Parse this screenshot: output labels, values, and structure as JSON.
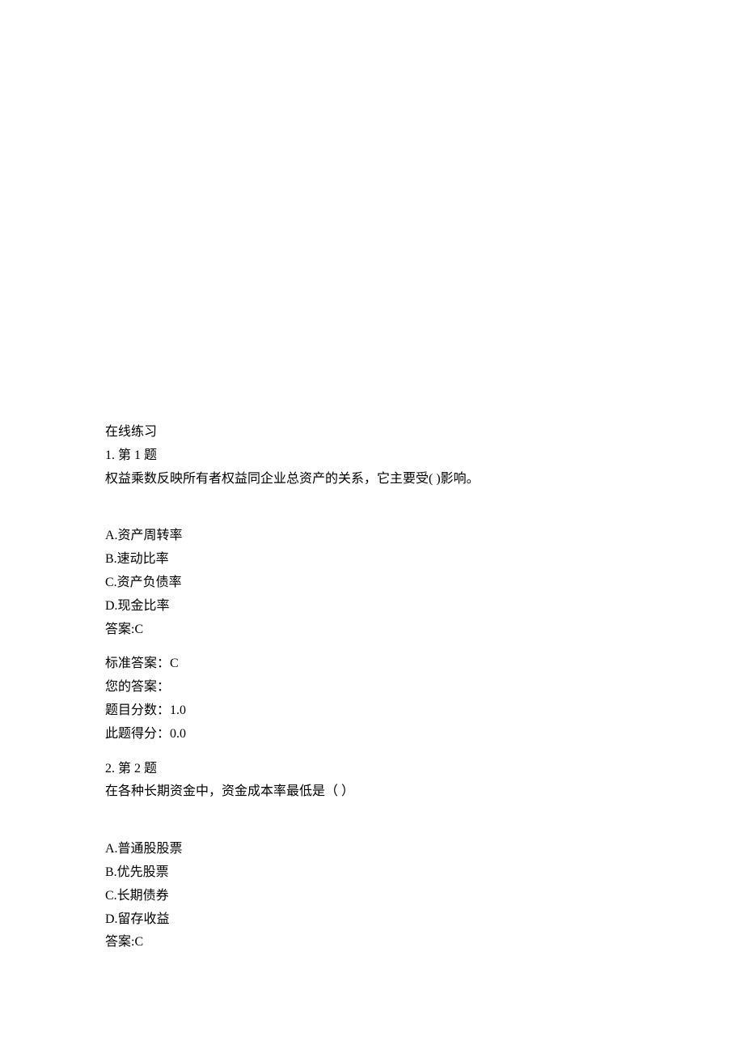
{
  "header": {
    "title": "在线练习"
  },
  "questions": [
    {
      "number_label": "1.  第 1 题",
      "stem": "权益乘数反映所有者权益同企业总资产的关系，它主要受( )影响。",
      "options": [
        "A.资产周转率",
        "B.速动比率",
        "C.资产负债率",
        "D.现金比率"
      ],
      "answer_line": "答案:C",
      "standard_answer_label": "标准答案：",
      "standard_answer_value": "C",
      "your_answer_label": "您的答案：",
      "your_answer_value": "",
      "question_score_label": "题目分数：",
      "question_score_value": "1.0",
      "obtained_score_label": "此题得分：",
      "obtained_score_value": "0.0"
    },
    {
      "number_label": "2.  第 2 题",
      "stem": "在各种长期资金中，资金成本率最低是（ ）",
      "options": [
        "A.普通股股票",
        "B.优先股票",
        "C.长期债券",
        "D.留存收益"
      ],
      "answer_line": "答案:C"
    }
  ]
}
